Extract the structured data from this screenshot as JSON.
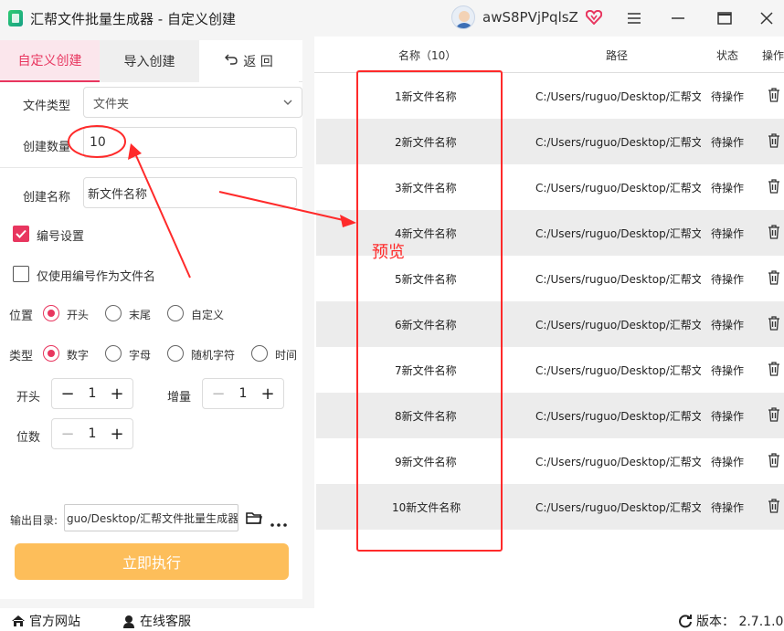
{
  "window": {
    "title": "汇帮文件批量生成器 - 自定义创建",
    "username": "awS8PVjPqlsZ"
  },
  "tabs": {
    "custom": "自定义创建",
    "import": "导入创建",
    "back": "返  回"
  },
  "form": {
    "file_type_label": "文件类型",
    "file_type_value": "文件夹",
    "count_label": "创建数量",
    "count_value": "10",
    "name_label": "创建名称",
    "name_value": "新文件名称",
    "numbering_label": "编号设置",
    "only_number_label": "仅使用编号作为文件名",
    "position_label": "位置",
    "position_options": [
      "开头",
      "末尾",
      "自定义"
    ],
    "position_selected": 0,
    "type_label": "类型",
    "type_options": [
      "数字",
      "字母",
      "随机字符",
      "时间"
    ],
    "type_selected": 0,
    "start_label": "开头",
    "start_value": "1",
    "increment_label": "增量",
    "increment_value": "1",
    "digits_label": "位数",
    "digits_value": "1",
    "output_label": "输出目录:",
    "output_value": "guo/Desktop/汇帮文件批量生成器",
    "run_button": "立即执行"
  },
  "table": {
    "headers": {
      "name": "名称（10）",
      "path": "路径",
      "status": "状态",
      "action": "操作"
    },
    "rows": [
      {
        "name": "1新文件名称",
        "path": "C:/Users/ruguo/Desktop/汇帮文",
        "status": "待操作"
      },
      {
        "name": "2新文件名称",
        "path": "C:/Users/ruguo/Desktop/汇帮文",
        "status": "待操作"
      },
      {
        "name": "3新文件名称",
        "path": "C:/Users/ruguo/Desktop/汇帮文",
        "status": "待操作"
      },
      {
        "name": "4新文件名称",
        "path": "C:/Users/ruguo/Desktop/汇帮文",
        "status": "待操作"
      },
      {
        "name": "5新文件名称",
        "path": "C:/Users/ruguo/Desktop/汇帮文",
        "status": "待操作"
      },
      {
        "name": "6新文件名称",
        "path": "C:/Users/ruguo/Desktop/汇帮文",
        "status": "待操作"
      },
      {
        "name": "7新文件名称",
        "path": "C:/Users/ruguo/Desktop/汇帮文",
        "status": "待操作"
      },
      {
        "name": "8新文件名称",
        "path": "C:/Users/ruguo/Desktop/汇帮文",
        "status": "待操作"
      },
      {
        "name": "9新文件名称",
        "path": "C:/Users/ruguo/Desktop/汇帮文",
        "status": "待操作"
      },
      {
        "name": "10新文件名称",
        "path": "C:/Users/ruguo/Desktop/汇帮文",
        "status": "待操作"
      }
    ]
  },
  "annotation": {
    "preview_label": "预览",
    "color": "#ff2a2a"
  },
  "footer": {
    "website": "官方网站",
    "support": "在线客服",
    "version": "版本： 2.7.1.0"
  },
  "colors": {
    "accent": "#e8365f",
    "run_button": "#fdbe5a"
  }
}
